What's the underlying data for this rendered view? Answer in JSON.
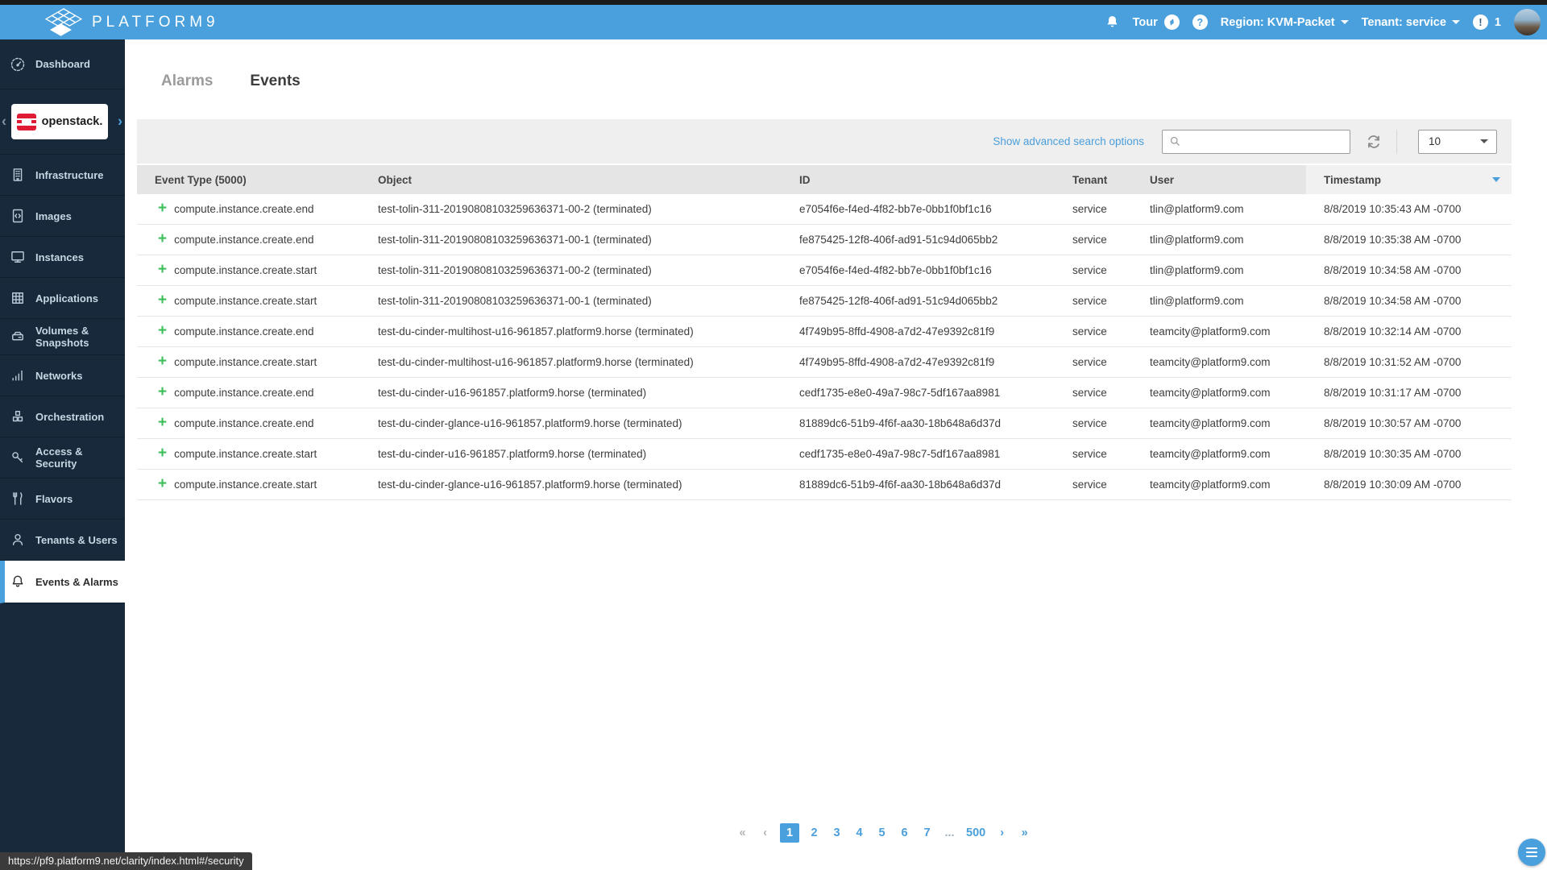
{
  "colors": {
    "topbar": "#4AA0DC",
    "sidebar": "#17293A",
    "accent": "#4AA0DC",
    "link": "#4A9FDB",
    "green": "#3EBE5B"
  },
  "topbar": {
    "brand": "PLATFORM9",
    "tour_label": "Tour",
    "help_glyph": "?",
    "region_label": "Region: KVM-Packet",
    "tenant_label": "Tenant: service",
    "alert_glyph": "!",
    "alert_count": "1"
  },
  "sidebar": {
    "top_items": [
      {
        "label": "Dashboard",
        "icon": "gauge-icon"
      }
    ],
    "openstack_logo_text": "openstack.",
    "chevron_left": "‹",
    "chevron_right": "›",
    "items": [
      {
        "label": "Infrastructure",
        "icon": "building-icon"
      },
      {
        "label": "Images",
        "icon": "image-file-icon"
      },
      {
        "label": "Instances",
        "icon": "monitor-icon"
      },
      {
        "label": "Applications",
        "icon": "grid-icon"
      },
      {
        "label": "Volumes & Snapshots",
        "icon": "storage-icon"
      },
      {
        "label": "Networks",
        "icon": "network-bars-icon"
      },
      {
        "label": "Orchestration",
        "icon": "cubes-icon"
      },
      {
        "label": "Access & Security",
        "icon": "key-icon"
      },
      {
        "label": "Flavors",
        "icon": "utensils-icon"
      },
      {
        "label": "Tenants & Users",
        "icon": "users-icon"
      },
      {
        "label": "Events & Alarms",
        "icon": "bell-icon",
        "active": true
      }
    ]
  },
  "tabs": [
    {
      "label": "Alarms",
      "active": false
    },
    {
      "label": "Events",
      "active": true
    }
  ],
  "toolbar": {
    "advanced_search_label": "Show advanced search options",
    "search_placeholder": "",
    "search_value": "",
    "page_size": "10"
  },
  "table": {
    "columns": [
      "Event Type (5000)",
      "Object",
      "ID",
      "Tenant",
      "User",
      "Timestamp"
    ],
    "sort_column": "Timestamp",
    "sort_direction": "desc",
    "plus_icon": "+",
    "rows": [
      {
        "event_type": "compute.instance.create.end",
        "object": "test-tolin-311-20190808103259636371-00-2 (terminated)",
        "id": "e7054f6e-f4ed-4f82-bb7e-0bb1f0bf1c16",
        "tenant": "service",
        "user": "tlin@platform9.com",
        "timestamp": "8/8/2019 10:35:43 AM -0700"
      },
      {
        "event_type": "compute.instance.create.end",
        "object": "test-tolin-311-20190808103259636371-00-1 (terminated)",
        "id": "fe875425-12f8-406f-ad91-51c94d065bb2",
        "tenant": "service",
        "user": "tlin@platform9.com",
        "timestamp": "8/8/2019 10:35:38 AM -0700"
      },
      {
        "event_type": "compute.instance.create.start",
        "object": "test-tolin-311-20190808103259636371-00-2 (terminated)",
        "id": "e7054f6e-f4ed-4f82-bb7e-0bb1f0bf1c16",
        "tenant": "service",
        "user": "tlin@platform9.com",
        "timestamp": "8/8/2019 10:34:58 AM -0700"
      },
      {
        "event_type": "compute.instance.create.start",
        "object": "test-tolin-311-20190808103259636371-00-1 (terminated)",
        "id": "fe875425-12f8-406f-ad91-51c94d065bb2",
        "tenant": "service",
        "user": "tlin@platform9.com",
        "timestamp": "8/8/2019 10:34:58 AM -0700"
      },
      {
        "event_type": "compute.instance.create.end",
        "object": "test-du-cinder-multihost-u16-961857.platform9.horse (terminated)",
        "id": "4f749b95-8ffd-4908-a7d2-47e9392c81f9",
        "tenant": "service",
        "user": "teamcity@platform9.com",
        "timestamp": "8/8/2019 10:32:14 AM -0700"
      },
      {
        "event_type": "compute.instance.create.start",
        "object": "test-du-cinder-multihost-u16-961857.platform9.horse (terminated)",
        "id": "4f749b95-8ffd-4908-a7d2-47e9392c81f9",
        "tenant": "service",
        "user": "teamcity@platform9.com",
        "timestamp": "8/8/2019 10:31:52 AM -0700"
      },
      {
        "event_type": "compute.instance.create.end",
        "object": "test-du-cinder-u16-961857.platform9.horse (terminated)",
        "id": "cedf1735-e8e0-49a7-98c7-5df167aa8981",
        "tenant": "service",
        "user": "teamcity@platform9.com",
        "timestamp": "8/8/2019 10:31:17 AM -0700"
      },
      {
        "event_type": "compute.instance.create.end",
        "object": "test-du-cinder-glance-u16-961857.platform9.horse (terminated)",
        "id": "81889dc6-51b9-4f6f-aa30-18b648a6d37d",
        "tenant": "service",
        "user": "teamcity@platform9.com",
        "timestamp": "8/8/2019 10:30:57 AM -0700"
      },
      {
        "event_type": "compute.instance.create.start",
        "object": "test-du-cinder-u16-961857.platform9.horse (terminated)",
        "id": "cedf1735-e8e0-49a7-98c7-5df167aa8981",
        "tenant": "service",
        "user": "teamcity@platform9.com",
        "timestamp": "8/8/2019 10:30:35 AM -0700"
      },
      {
        "event_type": "compute.instance.create.start",
        "object": "test-du-cinder-glance-u16-961857.platform9.horse (terminated)",
        "id": "81889dc6-51b9-4f6f-aa30-18b648a6d37d",
        "tenant": "service",
        "user": "teamcity@platform9.com",
        "timestamp": "8/8/2019 10:30:09 AM -0700"
      }
    ]
  },
  "pagination": {
    "items": [
      {
        "label": "«",
        "type": "nav-disabled",
        "name": "first-page"
      },
      {
        "label": "‹",
        "type": "nav-disabled",
        "name": "prev-page"
      },
      {
        "label": "1",
        "type": "page",
        "active": true
      },
      {
        "label": "2",
        "type": "page"
      },
      {
        "label": "3",
        "type": "page"
      },
      {
        "label": "4",
        "type": "page"
      },
      {
        "label": "5",
        "type": "page"
      },
      {
        "label": "6",
        "type": "page"
      },
      {
        "label": "7",
        "type": "page"
      },
      {
        "label": "...",
        "type": "ellipsis",
        "name": "ellipsis"
      },
      {
        "label": "500",
        "type": "page"
      },
      {
        "label": "›",
        "type": "nav",
        "name": "next-page"
      },
      {
        "label": "»",
        "type": "nav",
        "name": "last-page"
      }
    ]
  },
  "statusbar": {
    "url": "https://pf9.platform9.net/clarity/index.html#/security"
  }
}
